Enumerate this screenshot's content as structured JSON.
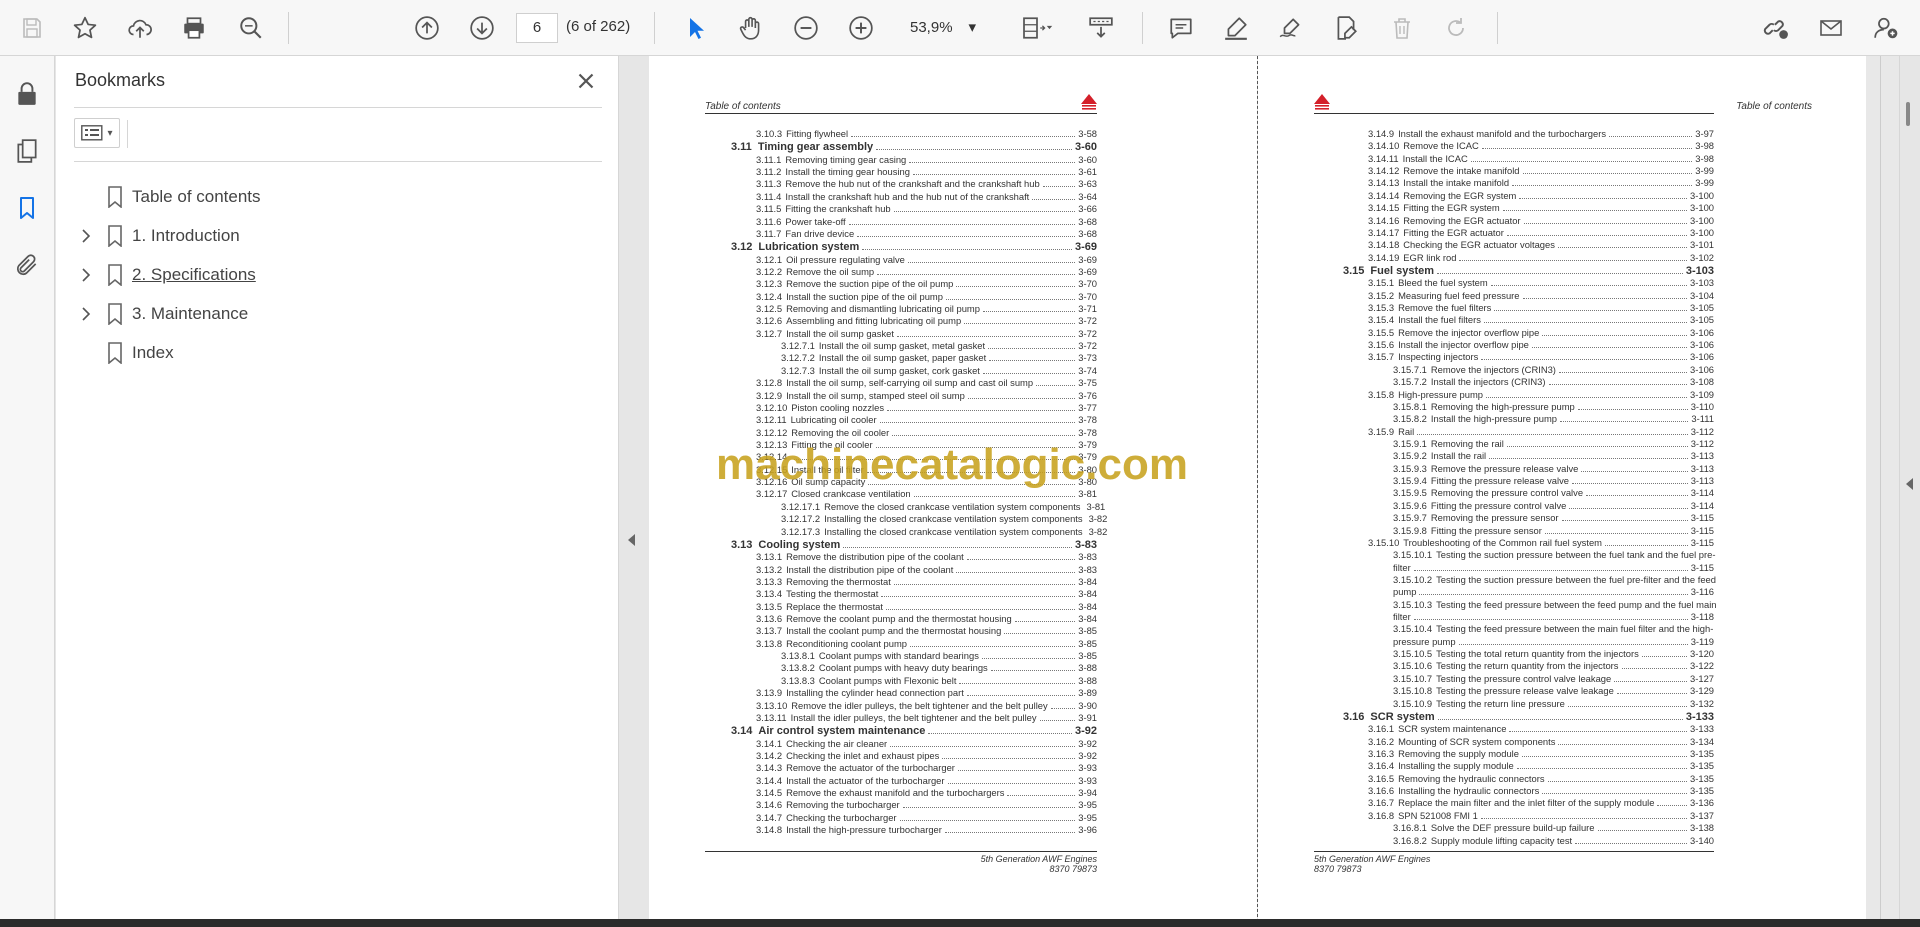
{
  "toolbar": {
    "page_current": "6",
    "page_count": "(6 of 262)",
    "zoom": "53,9%",
    "icons": [
      "save-icon",
      "star-icon",
      "upload-icon",
      "print-icon",
      "search-zoom-icon",
      "page-up-icon",
      "page-down-icon",
      "select-arrow-icon",
      "hand-icon",
      "zoom-out-icon",
      "zoom-in-icon",
      "page-fit-icon",
      "scroll-mode-icon",
      "comment-icon",
      "highlight-icon",
      "sign-icon",
      "edit-pdf-icon",
      "delete-icon",
      "redo-icon",
      "share-link-icon",
      "mail-icon",
      "user-icon"
    ]
  },
  "rail": {
    "icons": [
      "lock-icon",
      "pages-icon",
      "bookmark-icon",
      "attachment-icon"
    ]
  },
  "bookmarks": {
    "title": "Bookmarks",
    "items": [
      {
        "label": "Table of contents",
        "expandable": false
      },
      {
        "label": "1. Introduction",
        "expandable": true
      },
      {
        "label": "2. Specifications",
        "expandable": true
      },
      {
        "label": "3. Maintenance",
        "expandable": true
      },
      {
        "label": "Index",
        "expandable": false
      }
    ]
  },
  "page_left": {
    "header": "Table of contents",
    "footer_line1": "5th Generation AWF Engines",
    "footer_line2": "8370 79873",
    "entries": [
      {
        "lvl": 2,
        "num": "3.10.3",
        "text": "Fitting flywheel",
        "page": "3-58"
      },
      {
        "lvl": 1,
        "num": "3.11",
        "text": "Timing gear assembly",
        "page": "3-60"
      },
      {
        "lvl": 2,
        "num": "3.11.1",
        "text": "Removing timing gear casing",
        "page": "3-60"
      },
      {
        "lvl": 2,
        "num": "3.11.2",
        "text": "Install the timing gear housing",
        "page": "3-61"
      },
      {
        "lvl": 2,
        "num": "3.11.3",
        "text": "Remove the hub nut of the crankshaft and the crankshaft hub",
        "page": "3-63"
      },
      {
        "lvl": 2,
        "num": "3.11.4",
        "text": "Install the crankshaft hub and the hub nut of the crankshaft",
        "page": "3-64"
      },
      {
        "lvl": 2,
        "num": "3.11.5",
        "text": "Fitting the crankshaft hub",
        "page": "3-66"
      },
      {
        "lvl": 2,
        "num": "3.11.6",
        "text": "Power take-off",
        "page": "3-68"
      },
      {
        "lvl": 2,
        "num": "3.11.7",
        "text": "Fan drive device",
        "page": "3-68"
      },
      {
        "lvl": 1,
        "num": "3.12",
        "text": "Lubrication system",
        "page": "3-69"
      },
      {
        "lvl": 2,
        "num": "3.12.1",
        "text": "Oil pressure regulating valve",
        "page": "3-69"
      },
      {
        "lvl": 2,
        "num": "3.12.2",
        "text": "Remove the oil sump",
        "page": "3-69"
      },
      {
        "lvl": 2,
        "num": "3.12.3",
        "text": "Remove the suction pipe of the oil pump",
        "page": "3-70"
      },
      {
        "lvl": 2,
        "num": "3.12.4",
        "text": "Install the suction pipe of the oil pump",
        "page": "3-70"
      },
      {
        "lvl": 2,
        "num": "3.12.5",
        "text": "Removing and dismantling lubricating oil pump",
        "page": "3-71"
      },
      {
        "lvl": 2,
        "num": "3.12.6",
        "text": "Assembling and fitting lubricating oil pump",
        "page": "3-72"
      },
      {
        "lvl": 2,
        "num": "3.12.7",
        "text": "Install the oil sump gasket",
        "page": "3-72"
      },
      {
        "lvl": 3,
        "num": "3.12.7.1",
        "text": "Install the oil sump gasket, metal gasket",
        "page": "3-72"
      },
      {
        "lvl": 3,
        "num": "3.12.7.2",
        "text": "Install the oil sump gasket, paper gasket",
        "page": "3-73"
      },
      {
        "lvl": 3,
        "num": "3.12.7.3",
        "text": "Install the oil sump gasket, cork gasket",
        "page": "3-74"
      },
      {
        "lvl": 2,
        "num": "3.12.8",
        "text": "Install the oil sump, self-carrying oil sump and cast oil sump",
        "page": "3-75"
      },
      {
        "lvl": 2,
        "num": "3.12.9",
        "text": "Install the oil sump, stamped steel oil sump",
        "page": "3-76"
      },
      {
        "lvl": 2,
        "num": "3.12.10",
        "text": "Piston cooling nozzles",
        "page": "3-77"
      },
      {
        "lvl": 2,
        "num": "3.12.11",
        "text": "Lubricating oil cooler",
        "page": "3-78"
      },
      {
        "lvl": 2,
        "num": "3.12.12",
        "text": "Removing the oil cooler",
        "page": "3-78"
      },
      {
        "lvl": 2,
        "num": "3.12.13",
        "text": "Fitting the oil cooler",
        "page": "3-79"
      },
      {
        "lvl": 2,
        "num": "3.12.14",
        "text": "",
        "page": "3-79"
      },
      {
        "lvl": 2,
        "num": "3.12.15",
        "text": "Install the oil filter",
        "page": "3-80"
      },
      {
        "lvl": 2,
        "num": "3.12.16",
        "text": "Oil sump capacity",
        "page": "3-80"
      },
      {
        "lvl": 2,
        "num": "3.12.17",
        "text": "Closed crankcase ventilation",
        "page": "3-81"
      },
      {
        "lvl": 3,
        "num": "3.12.17.1",
        "text": "Remove the closed crankcase ventilation system components",
        "page": "3-81"
      },
      {
        "lvl": 3,
        "num": "3.12.17.2",
        "text": "Installing the closed crankcase ventilation system components",
        "page": "3-82"
      },
      {
        "lvl": 3,
        "num": "3.12.17.3",
        "text": "Installing the closed crankcase ventilation system components",
        "page": "3-82"
      },
      {
        "lvl": 1,
        "num": "3.13",
        "text": "Cooling system",
        "page": "3-83"
      },
      {
        "lvl": 2,
        "num": "3.13.1",
        "text": "Remove the distribution pipe of the coolant",
        "page": "3-83"
      },
      {
        "lvl": 2,
        "num": "3.13.2",
        "text": "Install the distribution pipe of the coolant",
        "page": "3-83"
      },
      {
        "lvl": 2,
        "num": "3.13.3",
        "text": "Removing the thermostat",
        "page": "3-84"
      },
      {
        "lvl": 2,
        "num": "3.13.4",
        "text": "Testing the thermostat",
        "page": "3-84"
      },
      {
        "lvl": 2,
        "num": "3.13.5",
        "text": "Replace the thermostat",
        "page": "3-84"
      },
      {
        "lvl": 2,
        "num": "3.13.6",
        "text": "Remove the coolant pump and the thermostat housing",
        "page": "3-84"
      },
      {
        "lvl": 2,
        "num": "3.13.7",
        "text": "Install the coolant pump and the thermostat housing",
        "page": "3-85"
      },
      {
        "lvl": 2,
        "num": "3.13.8",
        "text": "Reconditioning coolant pump",
        "page": "3-85"
      },
      {
        "lvl": 3,
        "num": "3.13.8.1",
        "text": "Coolant pumps with standard bearings",
        "page": "3-85"
      },
      {
        "lvl": 3,
        "num": "3.13.8.2",
        "text": "Coolant pumps with heavy duty bearings",
        "page": "3-88"
      },
      {
        "lvl": 3,
        "num": "3.13.8.3",
        "text": "Coolant pumps with Flexonic belt",
        "page": "3-88"
      },
      {
        "lvl": 2,
        "num": "3.13.9",
        "text": "Installing the cylinder head connection part",
        "page": "3-89"
      },
      {
        "lvl": 2,
        "num": "3.13.10",
        "text": "Remove the idler pulleys, the belt tightener and the belt pulley",
        "page": "3-90"
      },
      {
        "lvl": 2,
        "num": "3.13.11",
        "text": "Install the idler pulleys, the belt tightener and the belt pulley",
        "page": "3-91"
      },
      {
        "lvl": 1,
        "num": "3.14",
        "text": "Air control system maintenance",
        "page": "3-92"
      },
      {
        "lvl": 2,
        "num": "3.14.1",
        "text": "Checking the air cleaner",
        "page": "3-92"
      },
      {
        "lvl": 2,
        "num": "3.14.2",
        "text": "Checking the inlet and exhaust pipes",
        "page": "3-92"
      },
      {
        "lvl": 2,
        "num": "3.14.3",
        "text": "Remove the actuator of the turbocharger",
        "page": "3-93"
      },
      {
        "lvl": 2,
        "num": "3.14.4",
        "text": "Install the actuator of the turbocharger",
        "page": "3-93"
      },
      {
        "lvl": 2,
        "num": "3.14.5",
        "text": "Remove the exhaust manifold and the turbochargers",
        "page": "3-94"
      },
      {
        "lvl": 2,
        "num": "3.14.6",
        "text": "Removing the turbocharger",
        "page": "3-95"
      },
      {
        "lvl": 2,
        "num": "3.14.7",
        "text": "Checking the turbocharger",
        "page": "3-95"
      },
      {
        "lvl": 2,
        "num": "3.14.8",
        "text": "Install the high-pressure turbocharger",
        "page": "3-96"
      }
    ]
  },
  "page_right": {
    "header": "Table of contents",
    "footer_line1": "5th Generation AWF Engines",
    "footer_line2": "8370 79873",
    "entries": [
      {
        "lvl": 2,
        "num": "3.14.9",
        "text": "Install the exhaust manifold and the turbochargers",
        "page": "3-97"
      },
      {
        "lvl": 2,
        "num": "3.14.10",
        "text": "Remove the ICAC",
        "page": "3-98"
      },
      {
        "lvl": 2,
        "num": "3.14.11",
        "text": "Install the ICAC",
        "page": "3-98"
      },
      {
        "lvl": 2,
        "num": "3.14.12",
        "text": "Remove the intake manifold",
        "page": "3-99"
      },
      {
        "lvl": 2,
        "num": "3.14.13",
        "text": "Install the intake manifold",
        "page": "3-99"
      },
      {
        "lvl": 2,
        "num": "3.14.14",
        "text": "Removing the EGR system",
        "page": "3-100"
      },
      {
        "lvl": 2,
        "num": "3.14.15",
        "text": "Fitting the EGR system",
        "page": "3-100"
      },
      {
        "lvl": 2,
        "num": "3.14.16",
        "text": "Removing the EGR actuator",
        "page": "3-100"
      },
      {
        "lvl": 2,
        "num": "3.14.17",
        "text": "Fitting the EGR actuator",
        "page": "3-100"
      },
      {
        "lvl": 2,
        "num": "3.14.18",
        "text": " Checking the EGR actuator voltages",
        "page": "3-101"
      },
      {
        "lvl": 2,
        "num": "3.14.19",
        "text": "EGR link rod",
        "page": "3-102"
      },
      {
        "lvl": 1,
        "num": "3.15",
        "text": "Fuel system",
        "page": "3-103"
      },
      {
        "lvl": 2,
        "num": "3.15.1",
        "text": "Bleed the fuel system",
        "page": "3-103"
      },
      {
        "lvl": 2,
        "num": "3.15.2",
        "text": "Measuring fuel feed pressure",
        "page": "3-104"
      },
      {
        "lvl": 2,
        "num": "3.15.3",
        "text": "Remove the fuel filters",
        "page": "3-105"
      },
      {
        "lvl": 2,
        "num": "3.15.4",
        "text": "Install the fuel filters",
        "page": "3-105"
      },
      {
        "lvl": 2,
        "num": "3.15.5",
        "text": "Remove the injector overflow pipe",
        "page": "3-106"
      },
      {
        "lvl": 2,
        "num": "3.15.6",
        "text": "Install the injector overflow pipe",
        "page": "3-106"
      },
      {
        "lvl": 2,
        "num": "3.15.7",
        "text": "Inspecting injectors",
        "page": "3-106"
      },
      {
        "lvl": 3,
        "num": "3.15.7.1",
        "text": "Remove the injectors (CRIN3)",
        "page": "3-106"
      },
      {
        "lvl": 3,
        "num": "3.15.7.2",
        "text": "Install the injectors (CRIN3)",
        "page": "3-108"
      },
      {
        "lvl": 2,
        "num": "3.15.8",
        "text": "High-pressure pump",
        "page": "3-109"
      },
      {
        "lvl": 3,
        "num": "3.15.8.1",
        "text": "Removing the high-pressure pump",
        "page": "3-110"
      },
      {
        "lvl": 3,
        "num": "3.15.8.2",
        "text": "Install the high-pressure pump",
        "page": "3-111"
      },
      {
        "lvl": 2,
        "num": "3.15.9",
        "text": "Rail",
        "page": "3-112"
      },
      {
        "lvl": 3,
        "num": "3.15.9.1",
        "text": "Removing the rail",
        "page": "3-112"
      },
      {
        "lvl": 3,
        "num": "3.15.9.2",
        "text": "Install the rail",
        "page": "3-113"
      },
      {
        "lvl": 3,
        "num": "3.15.9.3",
        "text": "Remove the pressure release valve",
        "page": "3-113"
      },
      {
        "lvl": 3,
        "num": "3.15.9.4",
        "text": "Fitting the pressure release valve",
        "page": "3-113"
      },
      {
        "lvl": 3,
        "num": "3.15.9.5",
        "text": "Removing the pressure control valve",
        "page": "3-114"
      },
      {
        "lvl": 3,
        "num": "3.15.9.6",
        "text": "Fitting the pressure control valve",
        "page": "3-114"
      },
      {
        "lvl": 3,
        "num": "3.15.9.7",
        "text": "Removing the pressure sensor",
        "page": "3-115"
      },
      {
        "lvl": 3,
        "num": "3.15.9.8",
        "text": "Fitting the pressure sensor",
        "page": "3-115"
      },
      {
        "lvl": 2,
        "num": "3.15.10",
        "text": "Troubleshooting of the Common rail fuel system",
        "page": "3-115"
      },
      {
        "lvl": 3,
        "num": "3.15.10.1",
        "text": "Testing the suction pressure between the fuel tank and the fuel pre-",
        "cont": "filter",
        "page": "3-115"
      },
      {
        "lvl": 3,
        "num": "3.15.10.2",
        "text": "Testing the suction pressure between the fuel pre-filter and the feed",
        "cont": "pump",
        "page": "3-116"
      },
      {
        "lvl": 3,
        "num": "3.15.10.3",
        "text": "Testing the feed pressure between the feed pump and the fuel main",
        "cont": "filter",
        "page": "3-118"
      },
      {
        "lvl": 3,
        "num": "3.15.10.4",
        "text": "Testing the feed pressure between the main fuel filter and the high-",
        "cont": "pressure pump",
        "page": "3-119"
      },
      {
        "lvl": 3,
        "num": "3.15.10.5",
        "text": "Testing the total return quantity from the injectors",
        "page": "3-120"
      },
      {
        "lvl": 3,
        "num": "3.15.10.6",
        "text": "Testing the return quantity from the injectors",
        "page": "3-122"
      },
      {
        "lvl": 3,
        "num": "3.15.10.7",
        "text": "Testing the pressure control valve leakage",
        "page": "3-127"
      },
      {
        "lvl": 3,
        "num": "3.15.10.8",
        "text": "Testing the pressure release valve leakage",
        "page": "3-129"
      },
      {
        "lvl": 3,
        "num": "3.15.10.9",
        "text": "Testing the return line pressure",
        "page": "3-132"
      },
      {
        "lvl": 1,
        "num": "3.16",
        "text": "SCR system",
        "page": "3-133"
      },
      {
        "lvl": 2,
        "num": "3.16.1",
        "text": "SCR system maintenance",
        "page": "3-133"
      },
      {
        "lvl": 2,
        "num": "3.16.2",
        "text": "Mounting of SCR system components",
        "page": "3-134"
      },
      {
        "lvl": 2,
        "num": "3.16.3",
        "text": "Removing the supply module",
        "page": "3-135"
      },
      {
        "lvl": 2,
        "num": "3.16.4",
        "text": "Installing the supply module",
        "page": "3-135"
      },
      {
        "lvl": 2,
        "num": "3.16.5",
        "text": "Removing the hydraulic connectors",
        "page": "3-135"
      },
      {
        "lvl": 2,
        "num": "3.16.6",
        "text": "Installing the hydraulic connectors",
        "page": "3-135"
      },
      {
        "lvl": 2,
        "num": "3.16.7",
        "text": "Replace the main filter and the inlet filter of the supply module",
        "page": "3-136"
      },
      {
        "lvl": 2,
        "num": "3.16.8",
        "text": "SPN 521008 FMI 1",
        "page": "3-137"
      },
      {
        "lvl": 3,
        "num": "3.16.8.1",
        "text": "Solve the DEF pressure build-up failure",
        "page": "3-138"
      },
      {
        "lvl": 3,
        "num": "3.16.8.2",
        "text": "Supply module lifting capacity test",
        "page": "3-140"
      }
    ]
  },
  "watermark": "machinecatalogic.com",
  "colors": {
    "accent_blue": "#1473e6",
    "logo_red": "#d4202a",
    "watermark": "#c8a21e"
  }
}
